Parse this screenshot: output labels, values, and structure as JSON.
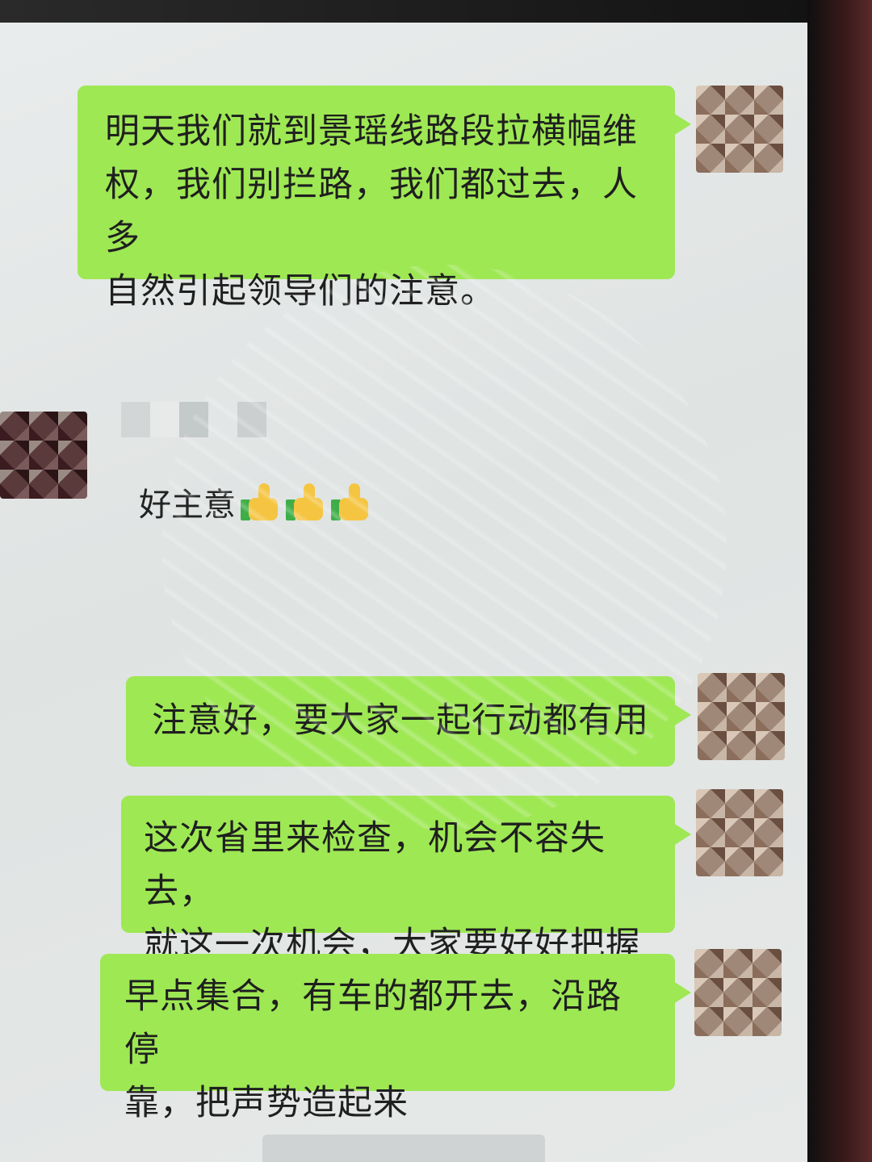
{
  "messages": [
    {
      "id": "m1",
      "side": "right",
      "lines": [
        "明天我们就到景瑶线路段拉横幅维",
        "权，我们别拦路，我们都过去，人多",
        "自然引起领导们的注意。"
      ]
    },
    {
      "id": "m2",
      "side": "left",
      "text": "好主意",
      "emoji": [
        "thumbs-up",
        "thumbs-up",
        "thumbs-up"
      ]
    },
    {
      "id": "m3",
      "side": "right",
      "lines": [
        "注意好，要大家一起行动都有用"
      ]
    },
    {
      "id": "m4",
      "side": "right",
      "lines": [
        "这次省里来检查，机会不容失去，",
        "就这一次机会，大家要好好把握"
      ]
    },
    {
      "id": "m5",
      "side": "right",
      "lines": [
        "早点集合，有车的都开去，沿路停",
        "靠，把声势造起来"
      ]
    }
  ],
  "colors": {
    "bubble_green": "#9ee854",
    "chat_background": "#e6e9e8"
  },
  "icons": {
    "avatar": "pixelated-avatar",
    "emoji": "thumbs-up-icon"
  }
}
